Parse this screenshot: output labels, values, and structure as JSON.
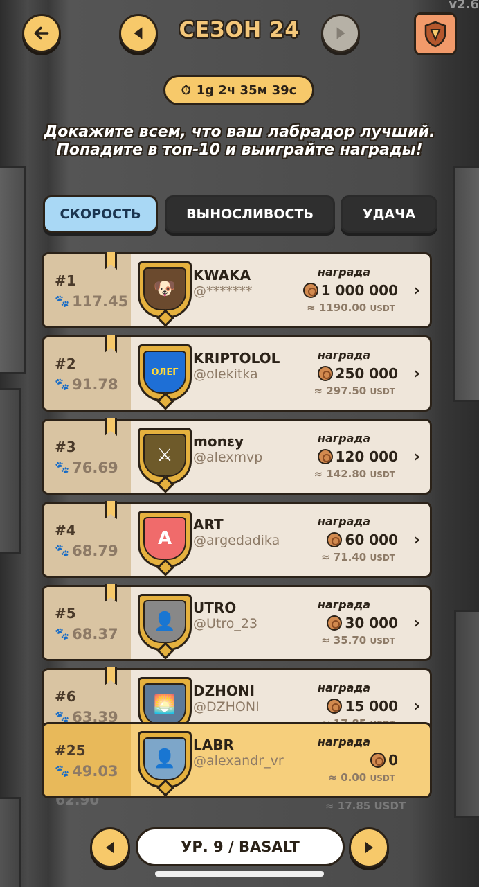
{
  "version": "v2.6",
  "header": {
    "season_title": "СЕЗОН 24",
    "timer": "1g 2ч 35м 39с"
  },
  "intro_text": "Докажите всем, что ваш лабрадор лучший. Попадите в топ-10 и выиграйте награды!",
  "tabs": [
    {
      "label": "СКОРОСТЬ",
      "active": true
    },
    {
      "label": "ВЫНОСЛИВОСТЬ",
      "active": false
    },
    {
      "label": "УДАЧА",
      "active": false
    }
  ],
  "reward_label": "награда",
  "leaderboard": [
    {
      "rank": "#1",
      "score": "117.45",
      "name": "KWAKA",
      "handle": "@*******",
      "reward": "1 000 000",
      "usdt": "≈ 1190.00",
      "avatar_color": "#6b4a2e",
      "avatar_glyph": "🐶"
    },
    {
      "rank": "#2",
      "score": "91.78",
      "name": "KRIPTOLOL",
      "handle": "@olekitka",
      "reward": "250 000",
      "usdt": "≈ 297.50",
      "avatar_color": "#1e6fd6",
      "avatar_glyph": "ОЛЕГ"
    },
    {
      "rank": "#3",
      "score": "76.69",
      "name": "monɛy",
      "handle": "@alexmvp",
      "reward": "120 000",
      "usdt": "≈ 142.80",
      "avatar_color": "#6e5a2a",
      "avatar_glyph": "⚔"
    },
    {
      "rank": "#4",
      "score": "68.79",
      "name": "ART",
      "handle": "@argedadika",
      "reward": "60 000",
      "usdt": "≈ 71.40",
      "avatar_color": "#f06b6b",
      "avatar_glyph": "A"
    },
    {
      "rank": "#5",
      "score": "68.37",
      "name": "UTRO",
      "handle": "@Utro_23",
      "reward": "30 000",
      "usdt": "≈ 35.70",
      "avatar_color": "#888888",
      "avatar_glyph": "👤"
    },
    {
      "rank": "#6",
      "score": "63.39",
      "name": "DZHONI",
      "handle": "@DZHONI",
      "reward": "15 000",
      "usdt": "≈ 17.85",
      "avatar_color": "#5c7a99",
      "avatar_glyph": "🌅"
    }
  ],
  "me": {
    "rank": "#25",
    "score": "49.03",
    "name": "LABR",
    "handle": "@alexandr_vr",
    "reward": "0",
    "usdt": "≈ 0.00",
    "avatar_color": "#7da6c9",
    "avatar_glyph": "👤"
  },
  "usdt_suffix": "USDT",
  "ghost_usdt": "≈ 17.85",
  "ghost_score": "62.90",
  "footer": {
    "level": "УР. 9 / BASALT"
  }
}
